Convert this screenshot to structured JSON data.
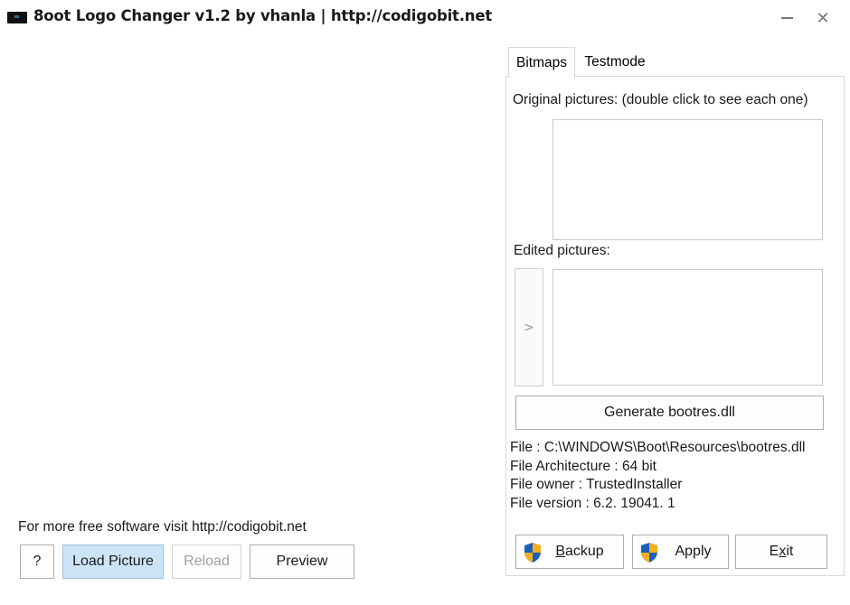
{
  "window": {
    "title": "8oot Logo Changer v1.2 by vhanla | http://codigobit.net",
    "controls": {
      "minimize_icon": "minimize-icon",
      "close_glyph": "✕"
    }
  },
  "tabs": [
    {
      "label": "Bitmaps",
      "active": true
    },
    {
      "label": "Testmode",
      "active": false
    }
  ],
  "bitmaps": {
    "original_label": "Original pictures: (double click to see each one)",
    "edited_label": "Edited pictures:",
    "move_button": ">",
    "generate_button": "Generate bootres.dll",
    "file_info": {
      "file": "File : C:\\WINDOWS\\Boot\\Resources\\bootres.dll",
      "architecture": "File Architecture : 64 bit",
      "owner": "File owner : TrustedInstaller",
      "version": "File version : 6.2. 19041. 1"
    },
    "actions": {
      "backup": {
        "label_prefix": "",
        "mnemonic": "B",
        "label_suffix": "ackup",
        "icon": "uac-shield-icon"
      },
      "apply": {
        "label": "Apply",
        "icon": "uac-shield-icon"
      },
      "exit": {
        "label_prefix": "E",
        "mnemonic": "x",
        "label_suffix": "it"
      }
    }
  },
  "footer": {
    "promo_text": "For more free software visit  http://codigobit.net",
    "help_button": "?",
    "load_button": "Load Picture",
    "reload_button": "Reload",
    "preview_button": "Preview"
  },
  "colors": {
    "load_button_bg": "#cce4f7",
    "shield_blue": "#1e5fb4",
    "shield_yellow": "#f2b01e"
  }
}
